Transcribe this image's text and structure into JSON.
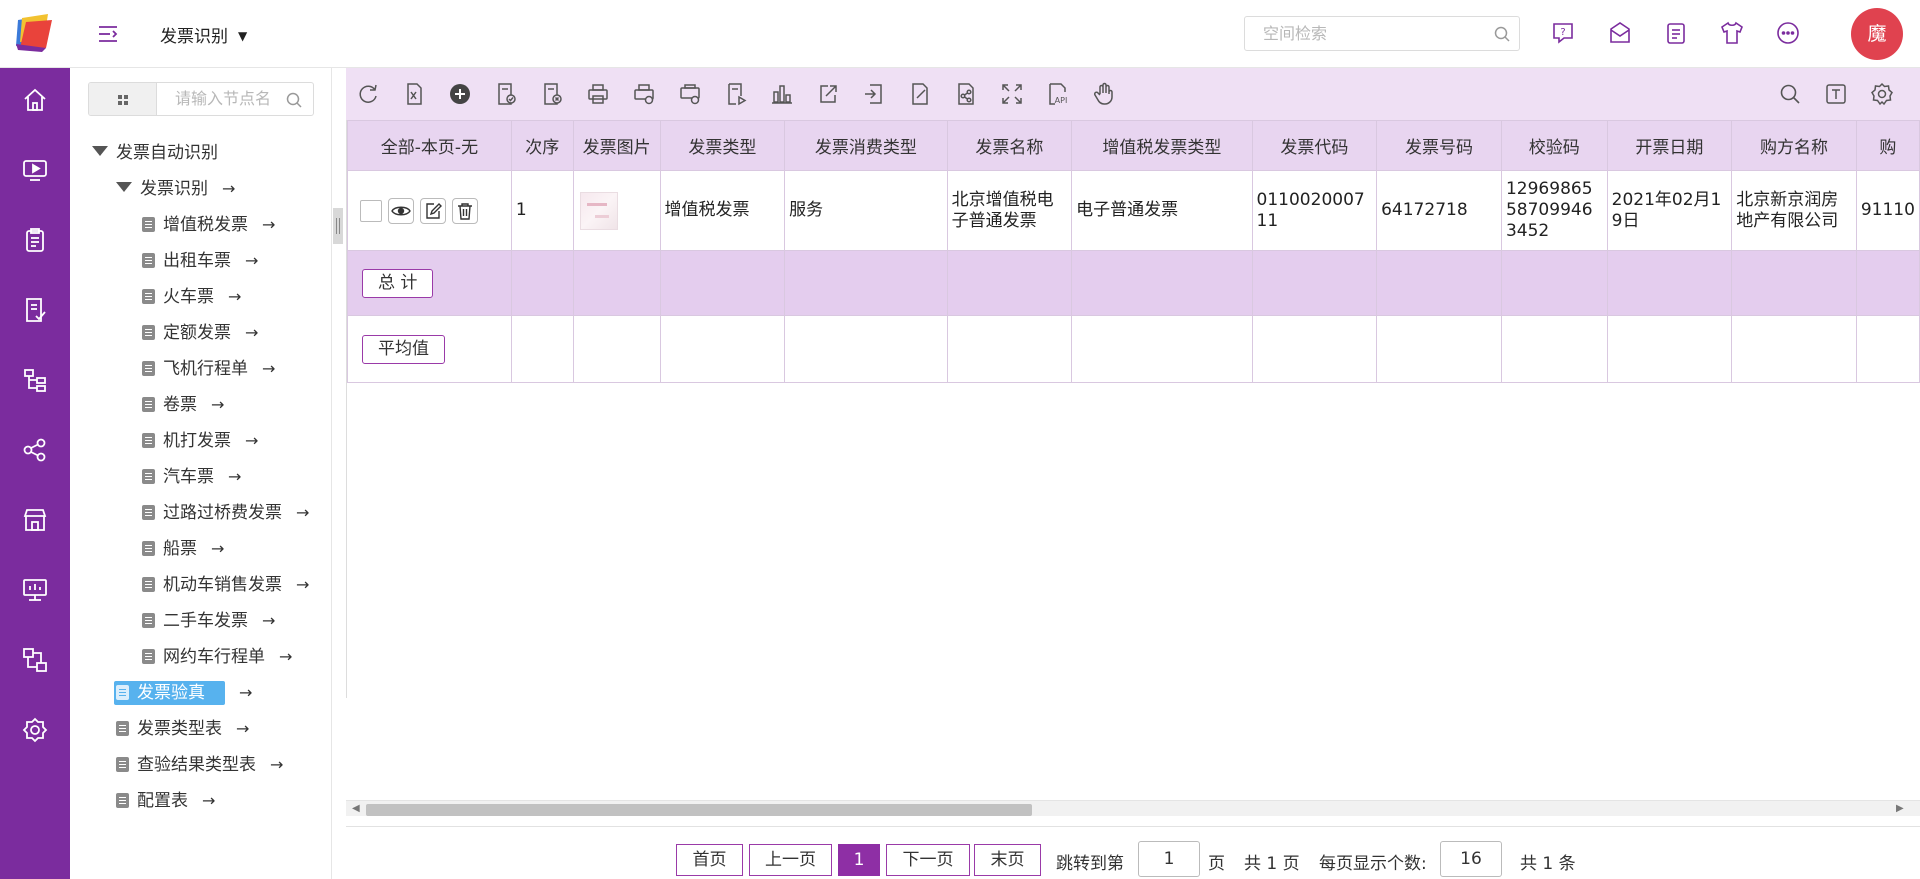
{
  "header": {
    "app_title": "发票识别",
    "search_placeholder": "空间检索",
    "avatar_text": "魔",
    "icons": [
      "help-icon",
      "mail-icon",
      "notes-icon",
      "shirt-icon",
      "more-icon"
    ]
  },
  "rail": {
    "items": [
      "home-icon",
      "video-icon",
      "clipboard-icon",
      "document-check-icon",
      "org-tree-icon",
      "share-icon",
      "store-icon",
      "monitor-icon",
      "workflow-icon",
      "settings-icon"
    ]
  },
  "tree": {
    "search_placeholder": "请输入节点名",
    "nodes": [
      {
        "label": "发票自动识别",
        "kind": "folder-open",
        "arrow": ""
      },
      {
        "label": "发票识别",
        "kind": "folder-open",
        "arrow": "→"
      },
      {
        "label": "增值税发票",
        "kind": "doc",
        "arrow": "→"
      },
      {
        "label": "出租车票",
        "kind": "doc",
        "arrow": "→"
      },
      {
        "label": "火车票",
        "kind": "doc",
        "arrow": "→"
      },
      {
        "label": "定额发票",
        "kind": "doc",
        "arrow": "→"
      },
      {
        "label": "飞机行程单",
        "kind": "doc",
        "arrow": "→"
      },
      {
        "label": "卷票",
        "kind": "doc",
        "arrow": "→"
      },
      {
        "label": "机打发票",
        "kind": "doc",
        "arrow": "→"
      },
      {
        "label": "汽车票",
        "kind": "doc",
        "arrow": "→"
      },
      {
        "label": "过路过桥费发票",
        "kind": "doc",
        "arrow": "→"
      },
      {
        "label": "船票",
        "kind": "doc",
        "arrow": "→"
      },
      {
        "label": "机动车销售发票",
        "kind": "doc",
        "arrow": "→"
      },
      {
        "label": "二手车发票",
        "kind": "doc",
        "arrow": "→"
      },
      {
        "label": "网约车行程单",
        "kind": "doc",
        "arrow": "→"
      },
      {
        "label": "发票验真",
        "kind": "doc",
        "arrow": "→",
        "selected": true
      },
      {
        "label": "发票类型表",
        "kind": "doc",
        "arrow": "→"
      },
      {
        "label": "查验结果类型表",
        "kind": "doc",
        "arrow": "→"
      },
      {
        "label": "配置表",
        "kind": "doc",
        "arrow": "→"
      }
    ]
  },
  "toolbar": {
    "icons": [
      "refresh-icon",
      "export-excel-icon",
      "add-icon",
      "approve-icon",
      "reject-icon",
      "print-icon",
      "print-settings-icon",
      "print-preview-icon",
      "play-icon",
      "chart-icon",
      "share-out-icon",
      "import-icon",
      "edit-export-icon",
      "share-icon",
      "fullscreen-icon",
      "api-icon",
      "hand-icon"
    ],
    "right_icons": [
      "search-icon",
      "text-format-icon",
      "gear-icon"
    ]
  },
  "table": {
    "columns": [
      "全部-本页-无",
      "次序",
      "发票图片",
      "发票类型",
      "发票消费类型",
      "发票名称",
      "增值税发票类型",
      "发票代码",
      "发票号码",
      "校验码",
      "开票日期",
      "购方名称",
      "购"
    ],
    "rows": [
      {
        "index": "1",
        "type": "增值税发票",
        "consume_type": "服务",
        "name": "北京增值税电子普通发票",
        "vat_type": "电子普通发票",
        "code": "011002000711",
        "number": "64172718",
        "check_code": "12969865587099463452",
        "date": "2021年02月19日",
        "buyer": "北京新京润房地产有限公司",
        "buyer_more": "91110"
      }
    ],
    "total_label": "总 计",
    "avg_label": "平均值"
  },
  "pager": {
    "first": "首页",
    "prev": "上一页",
    "current": "1",
    "next": "下一页",
    "last": "末页",
    "jump_label": "跳转到第",
    "jump_value": "1",
    "page_unit": "页",
    "total_pages": "共 1 页",
    "per_page_label": "每页显示个数:",
    "per_page_value": "16",
    "total_items": "共 1 条"
  },
  "colors": {
    "brand": "#7b2c9e",
    "toolbar_bg": "#efe0f4",
    "header_bg": "#e8d5f0",
    "total_bg": "#e4cdee",
    "selected": "#57b2ee",
    "avatar": "#e0424f"
  }
}
